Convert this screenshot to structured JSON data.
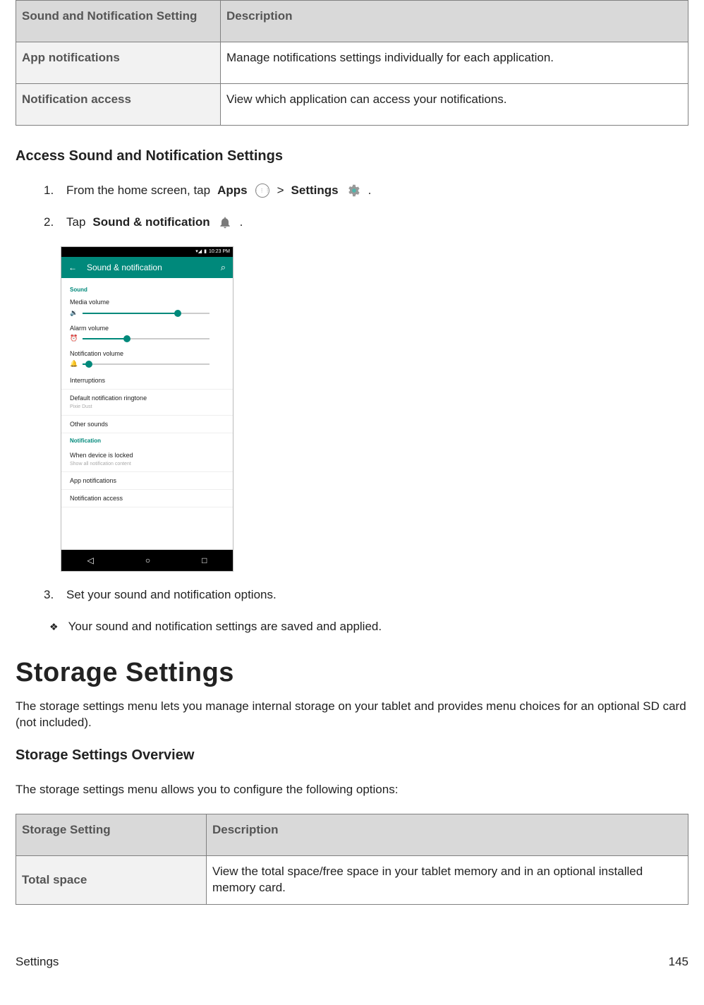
{
  "table1": {
    "header_1": "Sound and Notification Setting",
    "header_2": "Description",
    "rows": [
      {
        "k": "App notifications",
        "v": "Manage notifications settings individually for each application."
      },
      {
        "k": "Notification access",
        "v": "View which application can access your notifications."
      }
    ]
  },
  "section_title": "Access Sound and Notification Settings",
  "steps": {
    "s1_pre": "From the home screen, tap ",
    "s1_apps": "Apps",
    "s1_gt": " > ",
    "s1_settings": "Settings",
    "s1_post": ".",
    "s2_pre": "Tap ",
    "s2_bold": "Sound & notification",
    "s2_post": ".",
    "s3": "Set your sound and notification options."
  },
  "phone": {
    "time": "10:23 PM",
    "title": "Sound & notification",
    "sect_sound": "Sound",
    "media": "Media volume",
    "alarm": "Alarm volume",
    "notif_vol": "Notification volume",
    "interruptions": "Interruptions",
    "default_ring": "Default notification ringtone",
    "default_ring_sub": "Pixie Dust",
    "other": "Other sounds",
    "sect_notif": "Notification",
    "locked": "When device is locked",
    "locked_sub": "Show all notification content",
    "app_notif": "App notifications",
    "notif_access": "Notification access",
    "sliders": {
      "media": 75,
      "alarm": 35,
      "notif": 5
    }
  },
  "result_bullet": "Your sound and notification settings are saved and applied.",
  "h1": "Storage Settings",
  "h1_para": "The storage settings menu lets you manage internal storage on your tablet and provides menu choices for an optional SD card (not included).",
  "overview_title": "Storage Settings Overview",
  "overview_para": "The storage settings menu allows you to configure the following options:",
  "table2": {
    "header_1": "Storage Setting",
    "header_2": "Description",
    "rows": [
      {
        "k": "Total space",
        "v": "View the total space/free space in your tablet memory and in an optional installed memory card."
      }
    ]
  },
  "footer_left": "Settings",
  "footer_right": "145"
}
